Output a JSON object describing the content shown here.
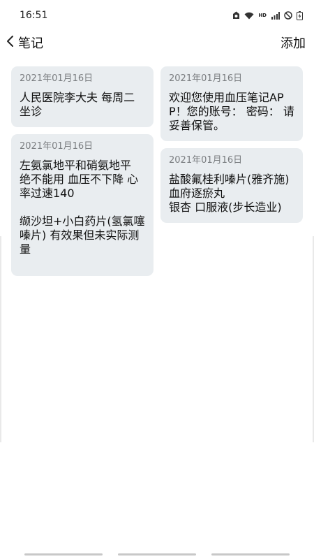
{
  "status_bar": {
    "time": "16:51",
    "hd_label": "HD",
    "icons": [
      "notification-icon",
      "wifi-icon",
      "hd-icon",
      "signal-icon",
      "do-not-disturb-icon",
      "battery-icon"
    ]
  },
  "nav": {
    "title": "笔记",
    "add_label": "添加"
  },
  "notes_left": [
    {
      "date": "2021年01月16日",
      "text": "人民医院李大夫 每周二坐诊"
    },
    {
      "date": "2021年01月16日",
      "text": "左氨氯地平和硝氨地平 绝不能用 血压不下降 心率过速140\n\n缬沙坦+小白药片(氢氯噻嗪片) 有效果但未实际测量"
    }
  ],
  "notes_right": [
    {
      "date": "2021年01月16日",
      "text": "欢迎您使用血压笔记APP！您的账号： 密码： 请妥善保管。"
    },
    {
      "date": "2021年01月16日",
      "text": "盐酸氟桂利嗪片(雅齐施)\n血府逐瘀丸\n银杏 口服液(步长造业)"
    }
  ]
}
